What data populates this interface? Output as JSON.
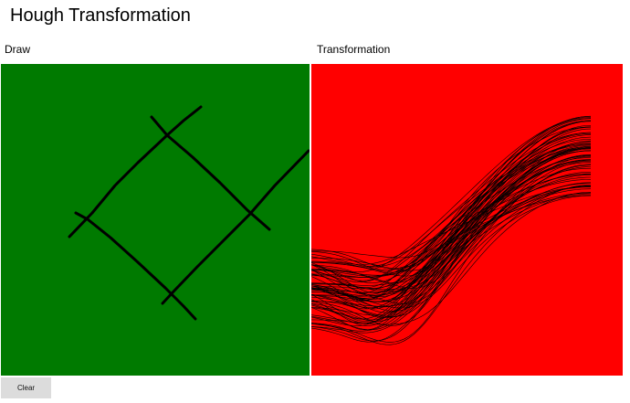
{
  "app": {
    "title": "Hough Transformation"
  },
  "panels": {
    "draw_label": "Draw",
    "transformation_label": "Transformation"
  },
  "controls": {
    "clear_label": "Clear"
  },
  "colors": {
    "draw_background": "#007a00",
    "transform_background": "#ff0000",
    "stroke": "#000000",
    "button_background": "#dcdcdc"
  }
}
